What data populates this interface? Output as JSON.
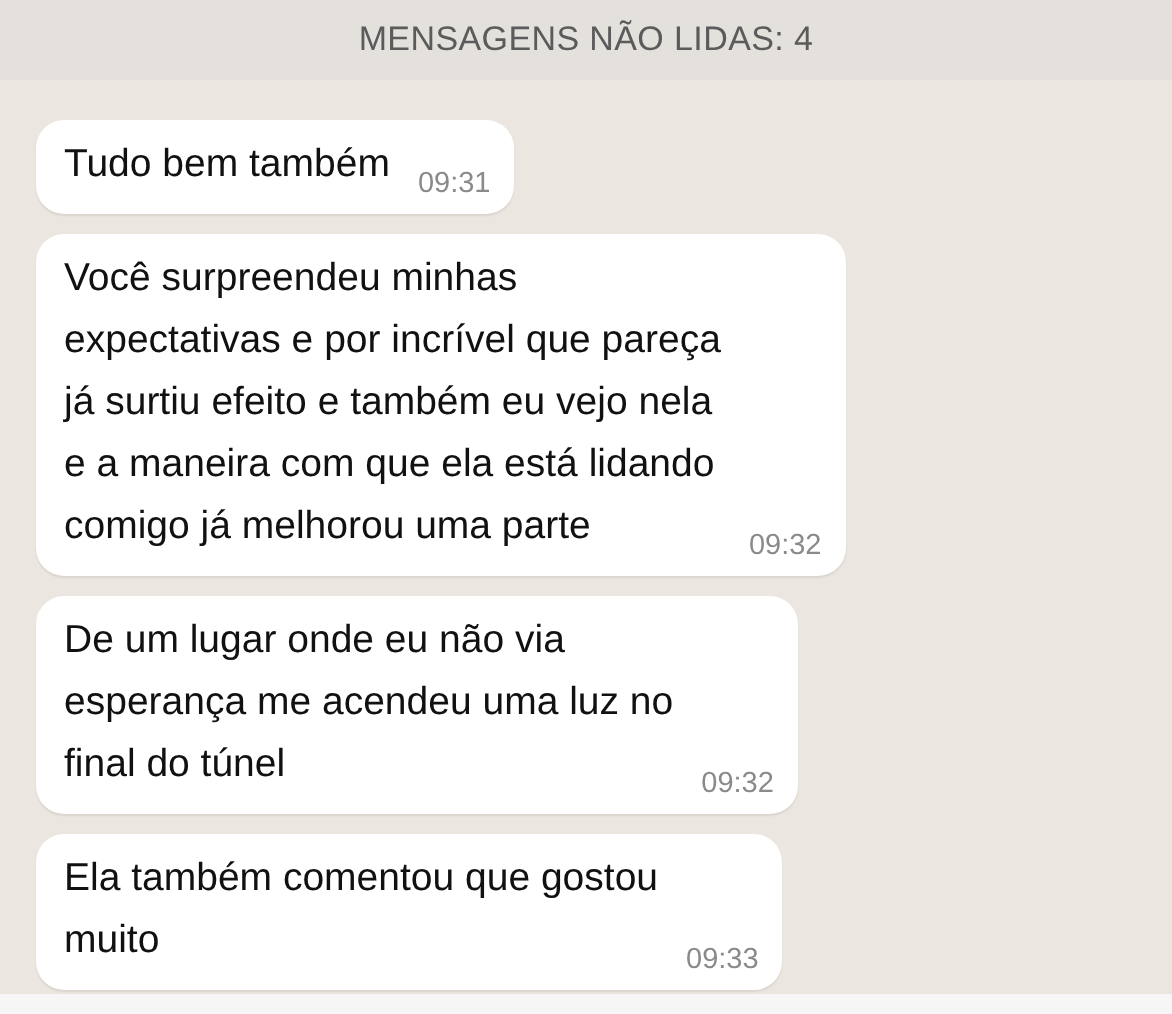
{
  "banner": {
    "text": "MENSAGENS NÃO LIDAS: 4"
  },
  "messages": [
    {
      "text": "Tudo bem também",
      "time": "09:31"
    },
    {
      "text": "Você surpreendeu minhas\nexpectativas e por incrível que pareça\njá surtiu efeito e também eu vejo nela\ne a maneira com que ela está lidando\ncomigo já melhorou uma parte",
      "time": "09:32"
    },
    {
      "text": "De um lugar onde eu não via\nesperança me acendeu uma luz no\nfinal do túnel",
      "time": "09:32"
    },
    {
      "text": "Ela também comentou que gostou\nmuito",
      "time": "09:33"
    }
  ]
}
